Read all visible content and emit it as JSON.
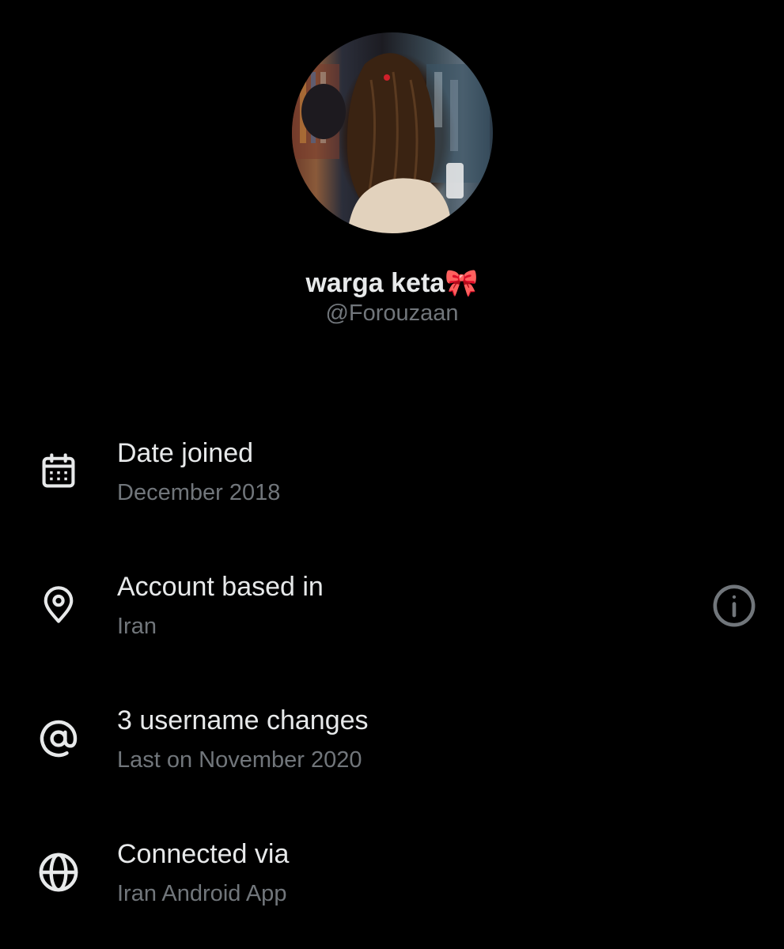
{
  "profile": {
    "display_name": "warga keta🎀",
    "handle": "@Forouzaan"
  },
  "details": [
    {
      "icon": "calendar-icon",
      "label": "Date joined",
      "value": "December 2018"
    },
    {
      "icon": "location-pin-icon",
      "label": "Account based in",
      "value": "Iran"
    },
    {
      "icon": "at-sign-icon",
      "label": "3 username changes",
      "value": "Last on November 2020"
    },
    {
      "icon": "globe-icon",
      "label": "Connected via",
      "value": "Iran Android App"
    }
  ],
  "colors": {
    "background": "#000000",
    "primary_text": "#e7e9ea",
    "secondary_text": "#71767b"
  }
}
